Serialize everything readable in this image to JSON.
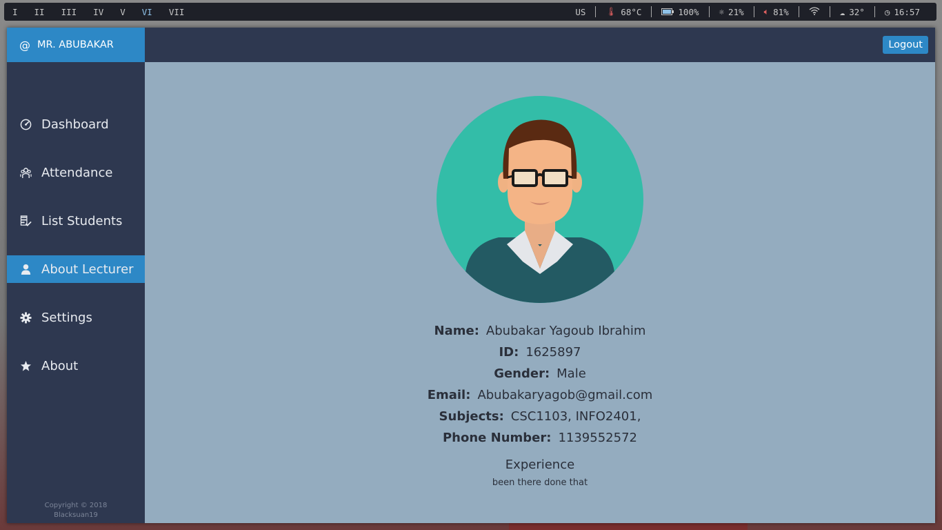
{
  "topbar": {
    "workspaces": [
      "I",
      "II",
      "III",
      "IV",
      "V",
      "VI",
      "VII"
    ],
    "active_workspace": "VI",
    "keyboard": "US",
    "temperature": "68°C",
    "battery": "100%",
    "brightness": "21%",
    "volume": "81%",
    "weather": "32°",
    "clock": "16:57"
  },
  "sidebar": {
    "brand": "MR. ABUBAKAR",
    "items": [
      {
        "label": "Dashboard",
        "icon": "dashboard-icon"
      },
      {
        "label": "Attendance",
        "icon": "attendance-icon"
      },
      {
        "label": "List Students",
        "icon": "list-students-icon"
      },
      {
        "label": "About Lecturer",
        "icon": "user-icon",
        "active": true
      },
      {
        "label": "Settings",
        "icon": "gear-icon"
      },
      {
        "label": "About",
        "icon": "star-icon"
      }
    ],
    "copyright_line1": "Copyright © 2018",
    "copyright_line2": "Blacksuan19"
  },
  "header": {
    "logout_label": "Logout"
  },
  "profile": {
    "fields": [
      {
        "label": "Name:",
        "value": "Abubakar Yagoub Ibrahim"
      },
      {
        "label": "ID:",
        "value": "1625897"
      },
      {
        "label": "Gender:",
        "value": "Male"
      },
      {
        "label": "Email:",
        "value": "Abubakaryagob@gmail.com"
      },
      {
        "label": "Subjects:",
        "value": "CSC1103, INFO2401,"
      },
      {
        "label": "Phone Number:",
        "value": "1139552572"
      }
    ],
    "experience_title": "Experience",
    "experience_text": "been there done that"
  },
  "colors": {
    "sidebar_bg": "#2e3850",
    "accent": "#2d88c6",
    "main_bg": "#94acbf",
    "avatar_bg": "#33bda8"
  }
}
